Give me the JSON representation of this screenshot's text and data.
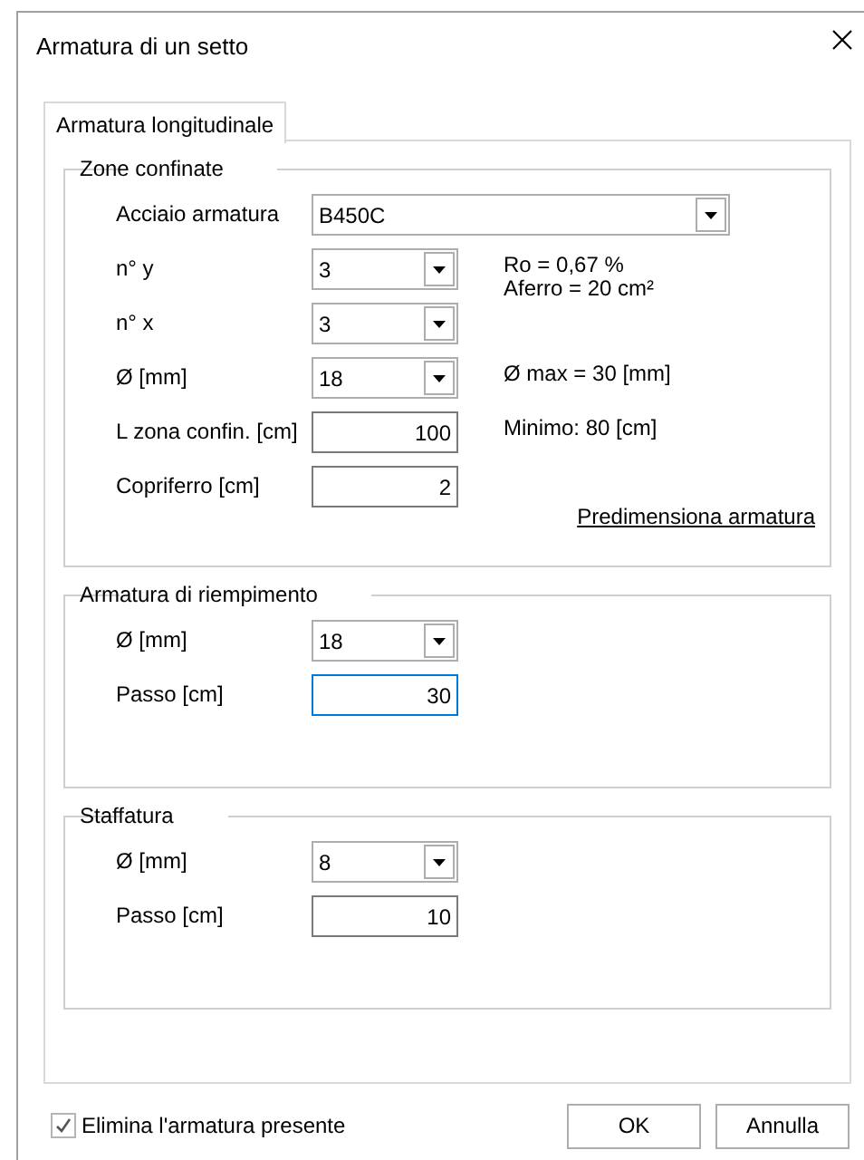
{
  "window": {
    "title": "Armatura di un setto"
  },
  "tabs": [
    {
      "label": "Armatura longitudinale",
      "selected": true
    }
  ],
  "groups": [
    {
      "title": "Zone confinate",
      "rows": [
        {
          "label": "Acciaio armatura",
          "kind": "wide-combo",
          "value": "B450C"
        },
        {
          "label": "n° y",
          "kind": "combo",
          "value": "3",
          "notes": [
            "Ro = 0,67 %",
            "Aferro = 20 cm²"
          ]
        },
        {
          "label": "n° x",
          "kind": "combo",
          "value": "3"
        },
        {
          "label": "Ø [mm]",
          "kind": "combo",
          "value": "18",
          "notes": [
            "Ø max = 30 [mm]"
          ]
        },
        {
          "label": "L zona confin. [cm]",
          "kind": "text",
          "value": "100",
          "focused": false,
          "notes": [
            "Minimo: 80 [cm]"
          ]
        },
        {
          "label": "Copriferro [cm]",
          "kind": "text",
          "value": "2",
          "focused": false
        }
      ],
      "link": "Predimensiona armatura"
    },
    {
      "title": "Armatura di riempimento",
      "rows": [
        {
          "label": "Ø [mm]",
          "kind": "combo",
          "value": "18"
        },
        {
          "label": "Passo [cm]",
          "kind": "text",
          "value": "30",
          "focused": true
        }
      ]
    },
    {
      "title": "Staffatura",
      "rows": [
        {
          "label": "Ø [mm]",
          "kind": "combo",
          "value": "8"
        },
        {
          "label": "Passo [cm]",
          "kind": "text",
          "value": "10",
          "focused": false
        }
      ]
    }
  ],
  "checkbox": {
    "label": "Elimina l'armatura presente",
    "checked": true
  },
  "buttons": [
    "OK",
    "Annulla"
  ]
}
